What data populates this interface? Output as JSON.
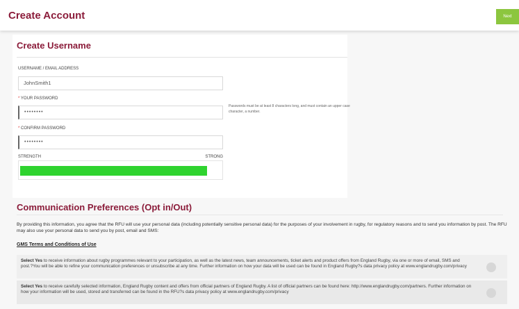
{
  "header": {
    "title": "Create Account",
    "next_label": "Next"
  },
  "create_username": {
    "heading": "Create Username",
    "username_label": "USERNAME / EMAIL ADDRESS",
    "username_value": "JohnSmith1",
    "password_label": "YOUR PASSWORD",
    "password_value": "••••••••",
    "password_hint": "Passwords must be at least 8 characters long, and must contain an upper case character, a number.",
    "confirm_label": "CONFIRM PASSWORD",
    "confirm_value": "••••••••",
    "required_mark": "*",
    "strength_label": "STRENGTH",
    "strength_value": "STRONG",
    "strength_fraction": 1.0,
    "strength_color": "#2fd32f"
  },
  "communication": {
    "heading": "Communication Preferences (Opt in/Out)",
    "intro": "By providing this information, you agree that the RFU will use your personal data (including potentially sensitive personal data) for the purposes of your involvement in rugby, for regulatory reasons and to send you information by post. The RFU may also use your personal data to send you by post, email and SMS:",
    "gms_link": "GMS Terms and Conditions of Use",
    "options": [
      {
        "yes": "Select Yes",
        "text": " to receive information about rugby programmes relevant to your participation, as well as the latest news, team announcements, ticket alerts and product offers from England Rugby, via one or more of email, SMS and post.?You will be able to refine your communication preferences or unsubscribe at any time. Further information on how your data will be used can be found in England Rugby?s data privacy policy at www.englandrugby.com/privacy"
      },
      {
        "yes": "Select Yes",
        "text": " to receive carefully selected information, England Rugby content and offers from official partners of England Rugby. A list of official partners can be found here: http://www.englandrugby.com/partners. Further information on how your information will be used, stored and transferred can be found in the RFU?s data privacy policy at www.englandrugby.com/privacy"
      }
    ]
  },
  "colors": {
    "brand": "#8b1c3a",
    "next_button": "#8cc63f"
  }
}
